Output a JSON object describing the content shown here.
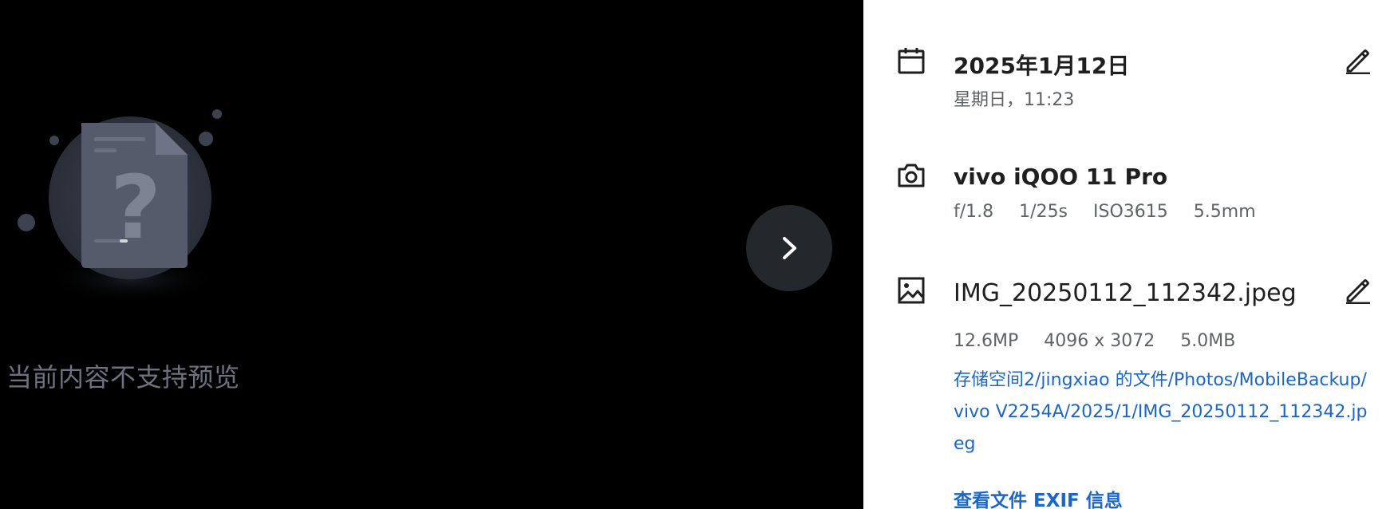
{
  "preview": {
    "message": "当前内容不支持预览"
  },
  "date_info": {
    "date": "2025年1月12日",
    "weekday_time": "星期日，11:23"
  },
  "camera_info": {
    "model": "vivo iQOO 11 Pro",
    "aperture": "f/1.8",
    "shutter": "1/25s",
    "iso": "ISO3615",
    "focal_length": "5.5mm"
  },
  "file_info": {
    "filename": "IMG_20250112_112342.jpeg",
    "megapixels": "12.6MP",
    "resolution": "4096 x 3072",
    "size": "5.0MB",
    "path": "存储空间2/jingxiao 的文件/Photos/MobileBackup/vivo V2254A/2025/1/IMG_20250112_112342.jpeg",
    "exif_link": "查看文件 EXIF 信息"
  },
  "colors": {
    "link": "#1a66c9",
    "panel_bg": "#ffffff",
    "preview_bg": "#000000",
    "placeholder_gray": "#545a6a"
  },
  "icons": {
    "date": "calendar-icon",
    "camera": "camera-icon",
    "file": "image-icon",
    "edit": "pencil-icon",
    "next": "chevron-right-icon",
    "placeholder": "unknown-file-icon"
  }
}
